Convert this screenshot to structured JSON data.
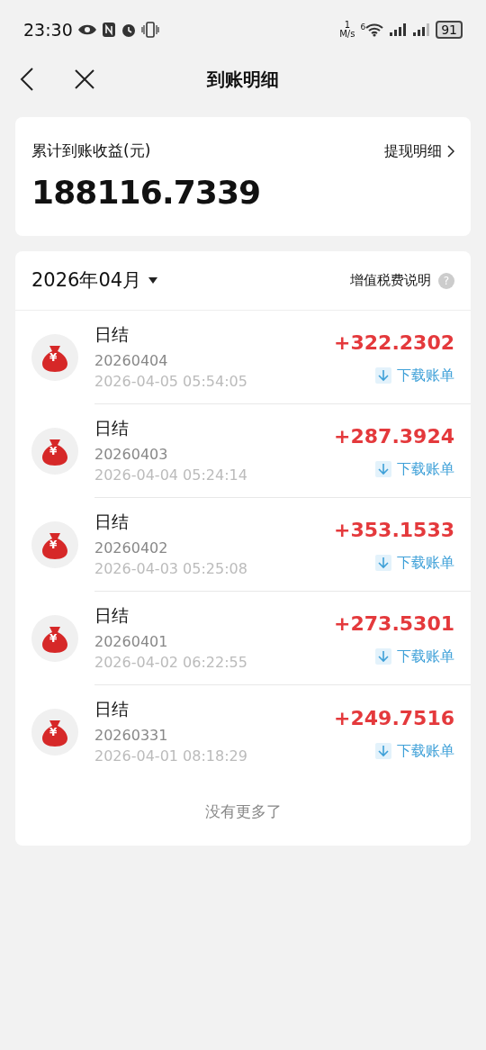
{
  "status_bar": {
    "time": "23:30",
    "speed_value": "1",
    "speed_unit": "M/s",
    "wifi_badge": "6",
    "battery": "91"
  },
  "nav": {
    "title": "到账明细"
  },
  "summary": {
    "label": "累计到账收益(元)",
    "link": "提现明细",
    "total": "188116.7339"
  },
  "list": {
    "month": "2026年04月",
    "tax_link": "增值税费说明",
    "help": "?",
    "items": [
      {
        "title": "日结",
        "badge": "¥",
        "code": "20260404",
        "time": "2026-04-05 05:54:05",
        "amount": "+322.2302",
        "action": "下载账单"
      },
      {
        "title": "日结",
        "badge": "¥",
        "code": "20260403",
        "time": "2026-04-04 05:24:14",
        "amount": "+287.3924",
        "action": "下载账单"
      },
      {
        "title": "日结",
        "badge": "¥",
        "code": "20260402",
        "time": "2026-04-03 05:25:08",
        "amount": "+353.1533",
        "action": "下载账单"
      },
      {
        "title": "日结",
        "badge": "¥",
        "code": "20260401",
        "time": "2026-04-02 06:22:55",
        "amount": "+273.5301",
        "action": "下载账单"
      },
      {
        "title": "日结",
        "badge": "¥",
        "code": "20260331",
        "time": "2026-04-01 08:18:29",
        "amount": "+249.7516",
        "action": "下载账单"
      }
    ],
    "footer": "没有更多了"
  }
}
